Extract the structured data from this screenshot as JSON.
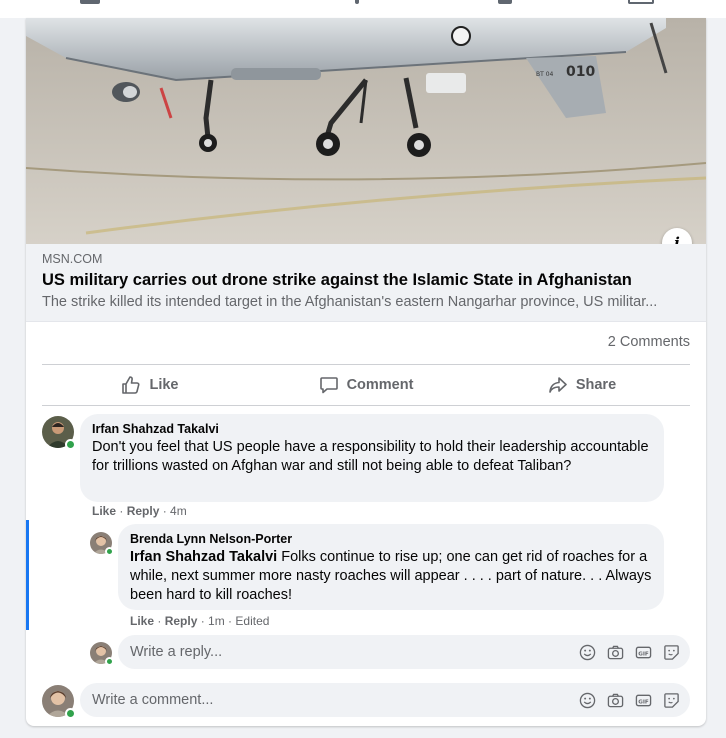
{
  "link": {
    "domain": "MSN.COM",
    "title": "US military carries out drone strike against the Islamic State in Afghanistan",
    "description": "The strike killed its intended target in the Afghanistan's eastern Nangarhar province, US militar...",
    "image_tail_number": "010",
    "image_tail_prefix": "BT 04"
  },
  "stats": {
    "comments": "2 Comments"
  },
  "actions": {
    "like": "Like",
    "comment": "Comment",
    "share": "Share"
  },
  "comments": [
    {
      "author": "Irfan Shahzad Takalvi",
      "text": "Don't you feel that US people have a responsibility to hold their leadership accountable for trillions wasted on Afghan war and still not being able to defeat Taliban?",
      "like": "Like",
      "reply": "Reply",
      "time": "4m",
      "replies": [
        {
          "author": "Brenda Lynn Nelson-Porter",
          "mention": "Irfan Shahzad Takalvi",
          "text": " Folks continue to rise up; one can get rid of roaches for a while, next summer more nasty roaches will appear . . . . part of nature. . . Always been hard to kill roaches!",
          "like": "Like",
          "reply": "Reply",
          "time": "1m",
          "edited": "Edited"
        }
      ]
    }
  ],
  "inputs": {
    "reply_placeholder": "Write a reply...",
    "comment_placeholder": "Write a comment..."
  },
  "icons": [
    "like-icon",
    "comment-icon",
    "share-icon",
    "emoji-icon",
    "camera-icon",
    "gif-icon",
    "sticker-icon",
    "info-icon"
  ],
  "colors": {
    "accent": "#1877f2",
    "online": "#31a24c",
    "muted": "#65676b"
  }
}
